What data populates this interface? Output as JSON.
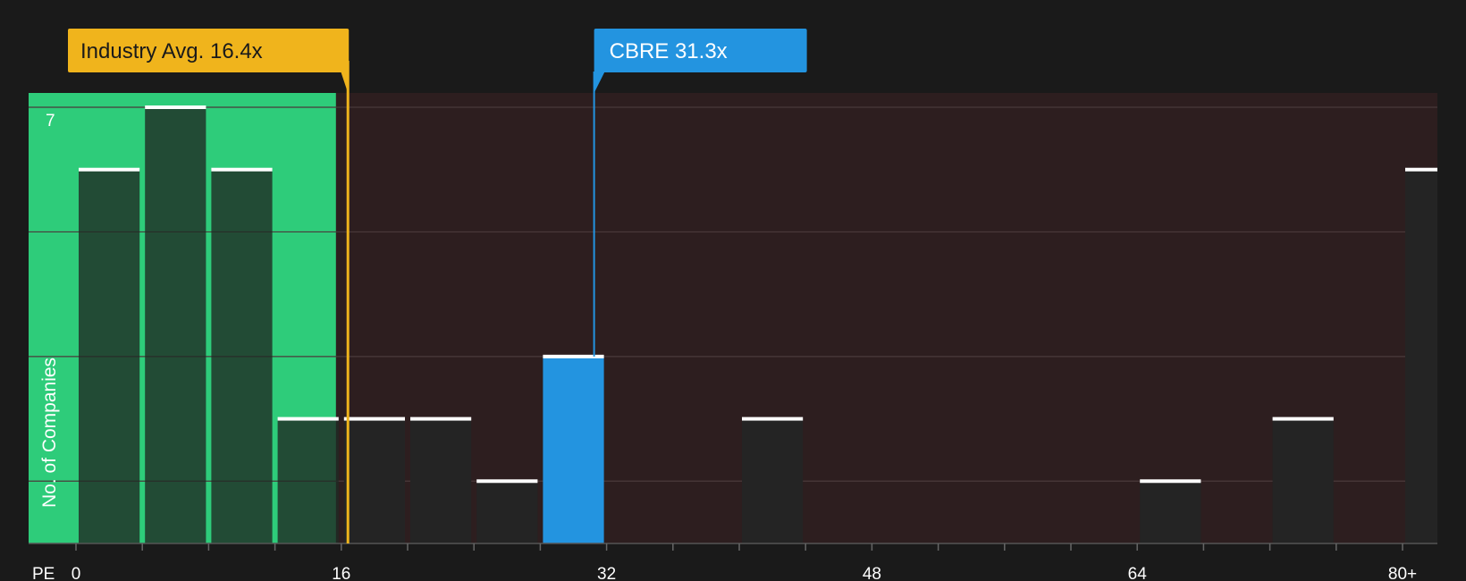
{
  "chart_data": {
    "type": "bar",
    "xlabel": "PE",
    "ylabel": "No. of Companies",
    "x_ticks": [
      {
        "value": 0,
        "label": "0"
      },
      {
        "value": 16,
        "label": "16"
      },
      {
        "value": 32,
        "label": "32"
      },
      {
        "value": 48,
        "label": "48"
      },
      {
        "value": 64,
        "label": "64"
      },
      {
        "value": 80,
        "label": "80+"
      }
    ],
    "y_tick_labels": [
      {
        "value": 7,
        "label": "7"
      }
    ],
    "xlim": [
      0,
      82
    ],
    "ylim": [
      0,
      7
    ],
    "bin_width": 4,
    "bars": [
      {
        "x0": 0,
        "x1": 4,
        "value": 6
      },
      {
        "x0": 4,
        "x1": 8,
        "value": 7
      },
      {
        "x0": 8,
        "x1": 12,
        "value": 6
      },
      {
        "x0": 12,
        "x1": 16,
        "value": 2
      },
      {
        "x0": 16,
        "x1": 20,
        "value": 2
      },
      {
        "x0": 20,
        "x1": 24,
        "value": 2
      },
      {
        "x0": 24,
        "x1": 28,
        "value": 1
      },
      {
        "x0": 28,
        "x1": 32,
        "value": 3,
        "highlight": true
      },
      {
        "x0": 40,
        "x1": 44,
        "value": 2
      },
      {
        "x0": 64,
        "x1": 68,
        "value": 1
      },
      {
        "x0": 72,
        "x1": 76,
        "value": 2
      },
      {
        "x0": 80,
        "x1": 84,
        "value": 6
      }
    ],
    "industry_avg": {
      "value": 16.4,
      "label": "Industry Avg. 16.4x"
    },
    "company": {
      "value": 31.3,
      "label": "CBRE 31.3x"
    },
    "colors": {
      "background": "#1a1a1a",
      "below_avg_zone": "#2ecc7a",
      "above_avg_zone": "#2d1e1f",
      "bar": "#242424",
      "bar_in_green": "#1e4a36",
      "highlight_bar": "#2394e0",
      "bar_top": "#ffffff",
      "industry_tag": "#f0b41c",
      "company_tag": "#2394e0",
      "axis_text": "#ffffff",
      "gridline": "#4a3a3b"
    }
  }
}
